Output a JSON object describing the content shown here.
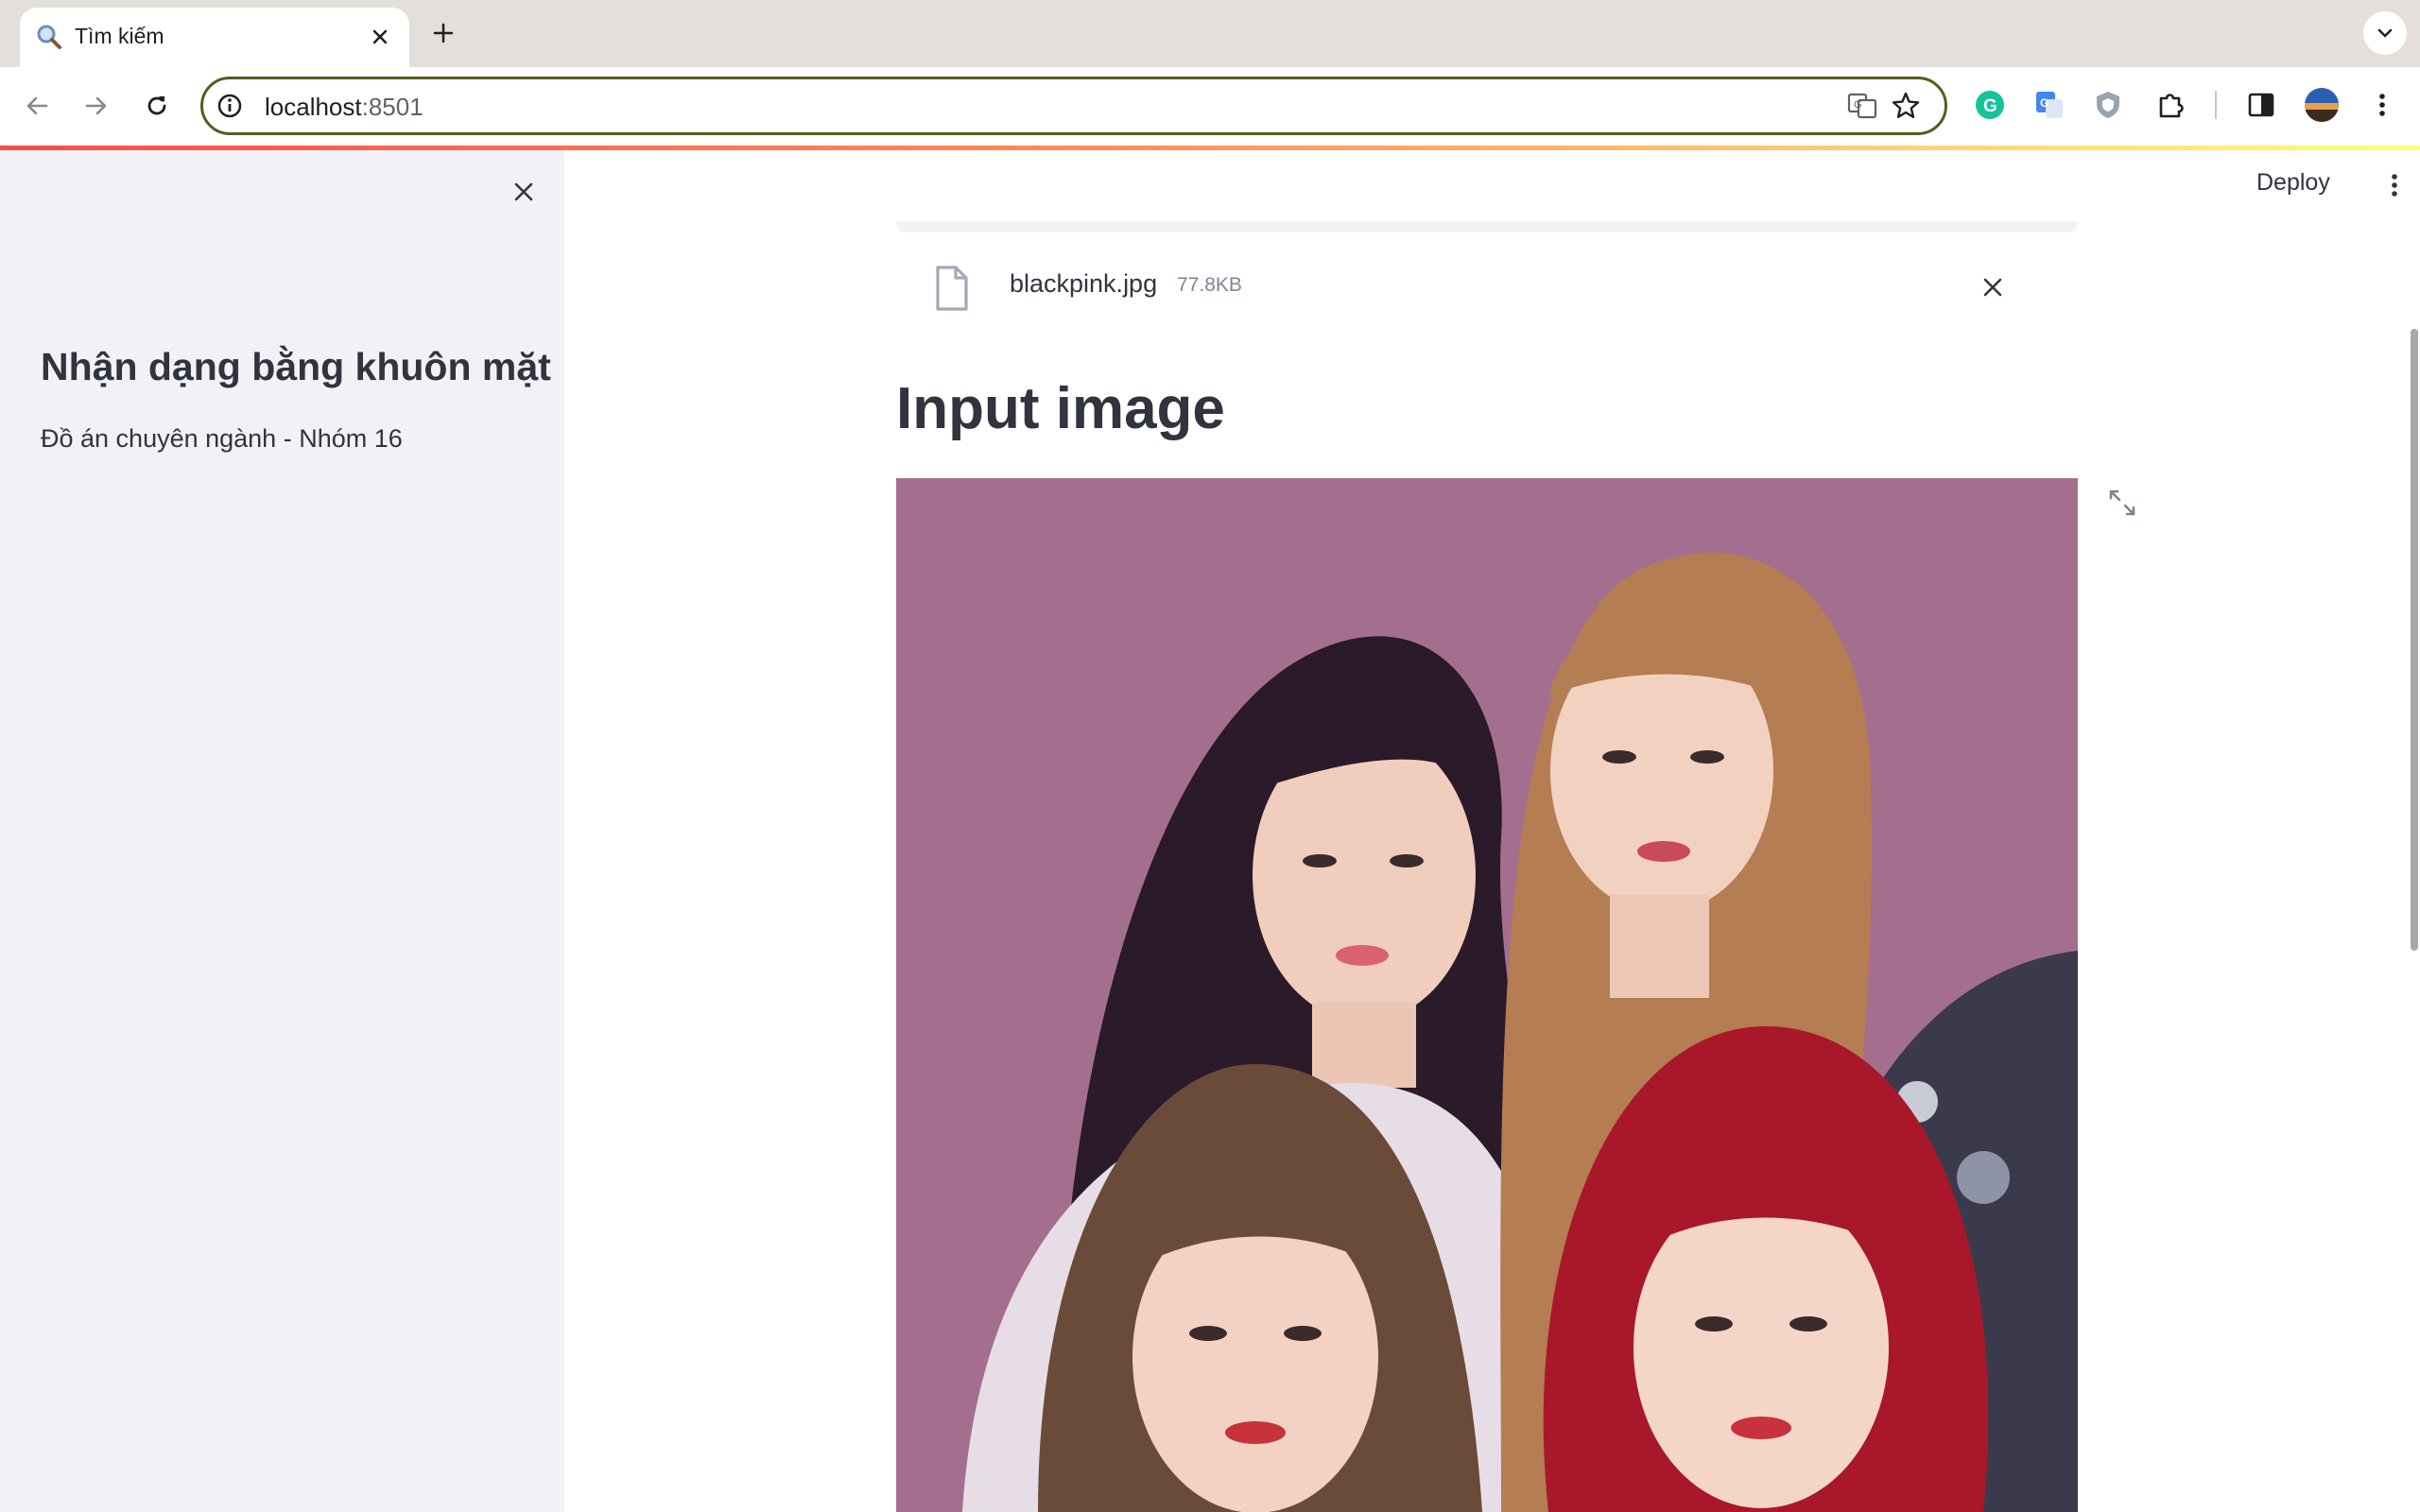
{
  "browser": {
    "tab_title": "Tìm kiếm",
    "url_host": "localhost",
    "url_port": ":8501"
  },
  "app": {
    "deploy_label": "Deploy",
    "sidebar": {
      "title": "Nhận dạng bằng khuôn mặt",
      "subtitle": "Đồ án chuyên ngành - Nhóm 16"
    },
    "uploaded_file": {
      "name": "blackpink.jpg",
      "size": "77.8KB"
    },
    "section_heading": "Input image"
  },
  "colors": {
    "accent": "#ff4b4b",
    "sidebar_bg": "#f0f2f6",
    "text": "#31333f",
    "photo_backdrop": "#a46f8f"
  }
}
